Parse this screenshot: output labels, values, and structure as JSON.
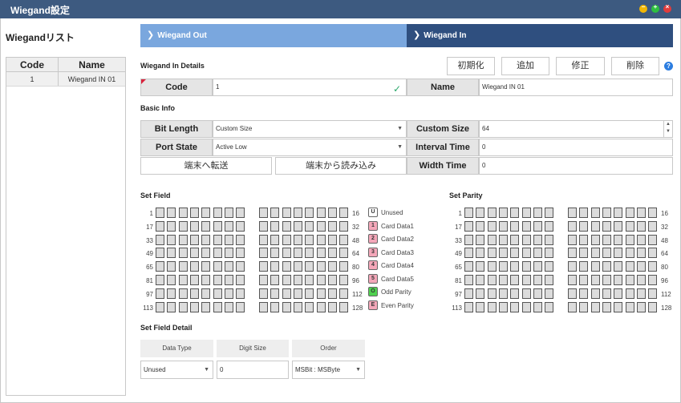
{
  "window": {
    "title": "Wiegand設定"
  },
  "left": {
    "title": "Wiegandリスト",
    "columns": {
      "code": "Code",
      "name": "Name"
    },
    "rows": [
      {
        "code": "1",
        "name": "Wiegand IN 01"
      }
    ]
  },
  "tabs": {
    "out": "Wiegand Out",
    "in": "Wiegand In"
  },
  "details": {
    "section_title": "Wiegand In Details",
    "buttons": {
      "init": "初期化",
      "add": "追加",
      "edit": "修正",
      "delete": "削除"
    },
    "help_icon": "?",
    "code_label": "Code",
    "code_value": "1",
    "name_label": "Name",
    "name_value": "Wiegand IN 01"
  },
  "basic_info": {
    "section_title": "Basic Info",
    "bit_length_label": "Bit Length",
    "bit_length_value": "Custom Size",
    "custom_size_label": "Custom Size",
    "custom_size_value": "64",
    "port_state_label": "Port State",
    "port_state_value": "Active Low",
    "interval_time_label": "Interval Time",
    "interval_time_value": "0",
    "send_button": "端末へ転送",
    "read_button": "端末から読み込み",
    "width_time_label": "Width Time",
    "width_time_value": "0"
  },
  "set_field": {
    "title": "Set Field",
    "row_labels_left": [
      "1",
      "17",
      "33",
      "49",
      "65",
      "81",
      "97",
      "113"
    ],
    "row_labels_right": [
      "16",
      "32",
      "48",
      "64",
      "80",
      "96",
      "112",
      "128"
    ],
    "legend": [
      {
        "badge": "U",
        "label": "Unused",
        "color": "#ffffff"
      },
      {
        "badge": "1",
        "label": "Card Data1",
        "color": "#f4a7b9"
      },
      {
        "badge": "2",
        "label": "Card Data2",
        "color": "#f4a7b9"
      },
      {
        "badge": "3",
        "label": "Card Data3",
        "color": "#f4a7b9"
      },
      {
        "badge": "4",
        "label": "Card Data4",
        "color": "#f4a7b9"
      },
      {
        "badge": "5",
        "label": "Card Data5",
        "color": "#f4a7b9"
      },
      {
        "badge": "O",
        "label": "Odd Parity",
        "color": "#4fd14f"
      },
      {
        "badge": "E",
        "label": "Even Parity",
        "color": "#f4a7b9"
      }
    ]
  },
  "set_parity": {
    "title": "Set Parity",
    "row_labels_left": [
      "1",
      "17",
      "33",
      "49",
      "65",
      "81",
      "97",
      "113"
    ],
    "row_labels_right": [
      "16",
      "32",
      "48",
      "64",
      "80",
      "96",
      "112",
      "128"
    ]
  },
  "field_detail": {
    "title": "Set Field Detail",
    "col_data_type": "Data Type",
    "col_digit_size": "Digit Size",
    "col_order": "Order",
    "data_type_value": "Unused",
    "digit_size_value": "0",
    "order_value": "MSBit : MSByte"
  },
  "colors": {
    "titlebar": "#3d5a80",
    "tab_out": "#7aa7de",
    "tab_in": "#2f4f7f",
    "cell": "#dcdcdc"
  }
}
